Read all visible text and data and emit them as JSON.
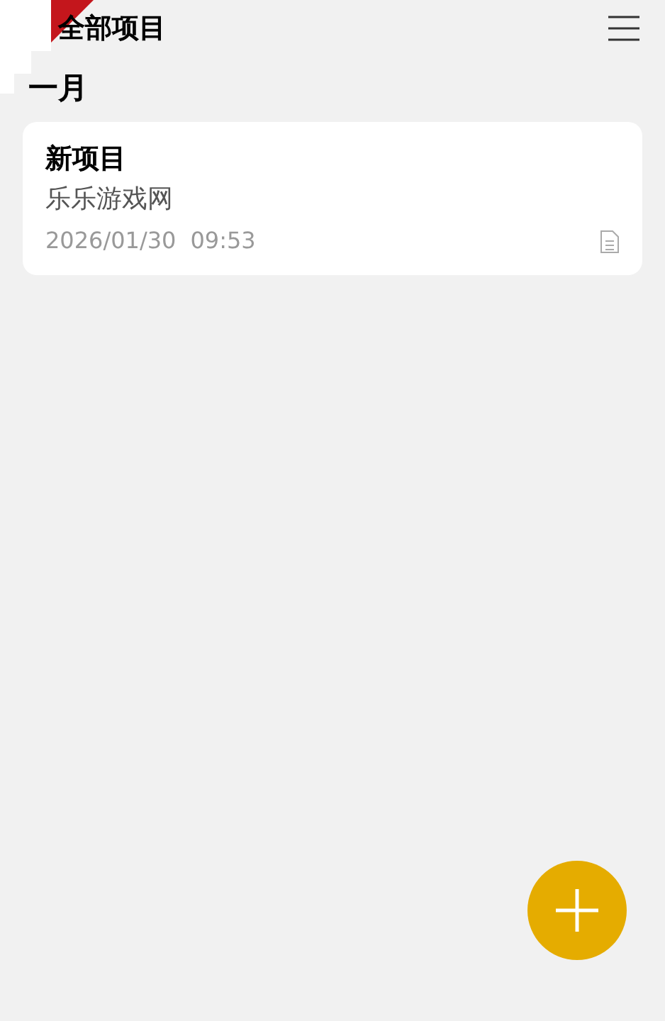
{
  "header": {
    "title": "全部项目"
  },
  "groups": [
    {
      "heading": "一月",
      "items": [
        {
          "title": "新项目",
          "subtitle": "乐乐游戏网",
          "date": "2026/01/30",
          "time": "09:53"
        }
      ]
    }
  ]
}
